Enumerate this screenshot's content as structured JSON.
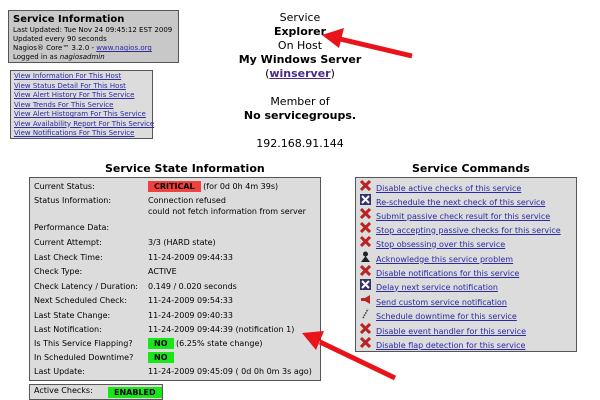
{
  "info": {
    "title": "Service Information",
    "last_updated": "Last Updated: Tue Nov 24 09:45:12 EST 2009",
    "update_interval": "Updated every 90 seconds",
    "version_prefix": "Nagios® Core™ 3.2.0 - ",
    "version_link": "www.nagios.org",
    "logged_in_prefix": "Logged in as ",
    "logged_in_user": "nagiosadmin"
  },
  "nav_links": [
    "View Information For This Host",
    "View Status Detail For This Host",
    "View Alert History For This Service",
    "View Trends For This Service",
    "View Alert Histogram For This Service",
    "View Availability Report For This Service",
    "View Notifications For This Service"
  ],
  "header": {
    "service_label": "Service",
    "service_name": "Explorer",
    "on_host": "On Host",
    "host_alias": "My Windows Server",
    "host_link": "winserver",
    "member_of": "Member of",
    "groups": "No servicegroups.",
    "address": "192.168.91.144"
  },
  "state": {
    "title": "Service State Information",
    "rows": [
      {
        "k": "Current Status:",
        "badge": "CRITICAL",
        "badge_color": "#f04040",
        "v": "(for 0d 0h 4m 39s)"
      },
      {
        "k": "Status Information:",
        "v": "Connection refused",
        "v2": "could not fetch information from server"
      },
      {
        "k": "Performance Data:",
        "v": ""
      },
      {
        "k": "Current Attempt:",
        "v": "3/3  (HARD state)"
      },
      {
        "k": "Last Check Time:",
        "v": "11-24-2009 09:44:33"
      },
      {
        "k": "Check Type:",
        "v": "ACTIVE"
      },
      {
        "k": "Check Latency / Duration:",
        "v": "0.149 / 0.020 seconds"
      },
      {
        "k": "Next Scheduled Check:",
        "v": "11-24-2009 09:54:33"
      },
      {
        "k": "Last State Change:",
        "v": "11-24-2009 09:40:33"
      },
      {
        "k": "Last Notification:",
        "v": "11-24-2009 09:44:39 (notification 1)"
      },
      {
        "k": "Is This Service Flapping?",
        "badge": "NO",
        "badge_color": "#19e619",
        "v": "(6.25% state change)"
      },
      {
        "k": "In Scheduled Downtime?",
        "badge": "NO",
        "badge_color": "#19e619",
        "v": ""
      },
      {
        "k": "Last Update:",
        "v": "11-24-2009 09:45:09  ( 0d 0h 0m 3s ago)"
      }
    ]
  },
  "checks": {
    "label": "Active Checks:",
    "badge": "ENABLED"
  },
  "commands": {
    "title": "Service Commands",
    "items": [
      {
        "label": "Disable active checks of this service",
        "icon": "disabled-icon"
      },
      {
        "label": "Re-schedule the next check of this service",
        "icon": "delay-icon"
      },
      {
        "label": "Submit passive check result for this service",
        "icon": "passive-icon"
      },
      {
        "label": "Stop accepting passive checks for this service",
        "icon": "disabled-icon"
      },
      {
        "label": "Stop obsessing over this service",
        "icon": "disabled-icon"
      },
      {
        "label": "Acknowledge this service problem",
        "icon": "ack-icon"
      },
      {
        "label": "Disable notifications for this service",
        "icon": "disabled-icon"
      },
      {
        "label": "Delay next service notification",
        "icon": "delay-icon"
      },
      {
        "label": "Send custom service notification",
        "icon": "notify-icon"
      },
      {
        "label": "Schedule downtime for this service",
        "icon": "downtime-icon"
      },
      {
        "label": "Disable event handler for this service",
        "icon": "disabled-icon"
      },
      {
        "label": "Disable flap detection for this service",
        "icon": "disabled-icon"
      }
    ]
  },
  "colors": {
    "accent_red": "#e8141a",
    "link": "#2a2aa5"
  }
}
